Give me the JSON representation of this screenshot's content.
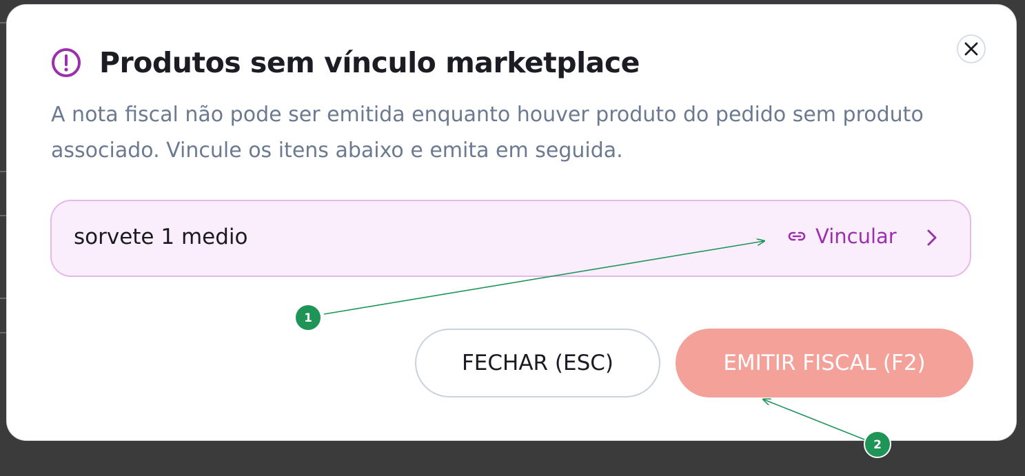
{
  "modal": {
    "title": "Produtos sem vínculo marketplace",
    "description": "A nota fiscal não pode ser emitida enquanto houver produto do pedido sem produto associado. Vincule os itens abaixo e emita em seguida.",
    "close_icon": "close-icon",
    "warning_icon": "exclamation-circle-icon"
  },
  "products": [
    {
      "name": "sorvete 1 medio",
      "action_label": "Vincular",
      "action_icon": "link-icon",
      "chevron_icon": "chevron-right-icon"
    }
  ],
  "buttons": {
    "close_label": "FECHAR (ESC)",
    "emit_label": "EMITIR FISCAL (F2)"
  },
  "annotations": [
    {
      "label": "1"
    },
    {
      "label": "2"
    }
  ],
  "colors": {
    "accent_purple": "#9b2fae",
    "row_background": "#fbeefc",
    "row_border": "#e6b8ea",
    "emit_button": "#f4a19a",
    "annotation_green": "#1e9457",
    "description_text": "#6b7a90"
  }
}
